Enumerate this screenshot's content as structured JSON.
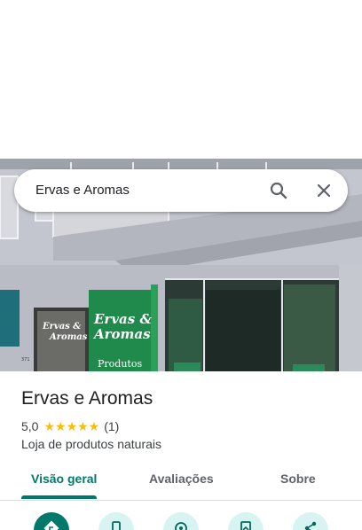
{
  "search": {
    "query": "Ervas e Aromas"
  },
  "hero": {
    "sign_line1": "Ervas &",
    "sign_line2": "Aromas",
    "sign_line3": "Produtos",
    "side_sign_line1": "Ervas &",
    "side_sign_line2": "Aromas",
    "street_number": "371"
  },
  "place": {
    "title": "Ervas e Aromas",
    "rating": "5,0",
    "stars": "★★★★★",
    "review_count": "(1)",
    "category": "Loja de produtos naturais"
  },
  "tabs": [
    {
      "label": "Visão geral",
      "active": true
    },
    {
      "label": "Avaliações",
      "active": false
    },
    {
      "label": "Sobre",
      "active": false
    }
  ],
  "actions": [
    {
      "icon": "directions-icon"
    },
    {
      "icon": "phone-icon"
    },
    {
      "icon": "save-icon"
    },
    {
      "icon": "add-photo-icon"
    },
    {
      "icon": "share-icon"
    }
  ],
  "colors": {
    "accent": "#00796b",
    "action_bg": "#d7f3f2",
    "star": "#fbbc04",
    "sign_green": "#1f8a4c"
  }
}
